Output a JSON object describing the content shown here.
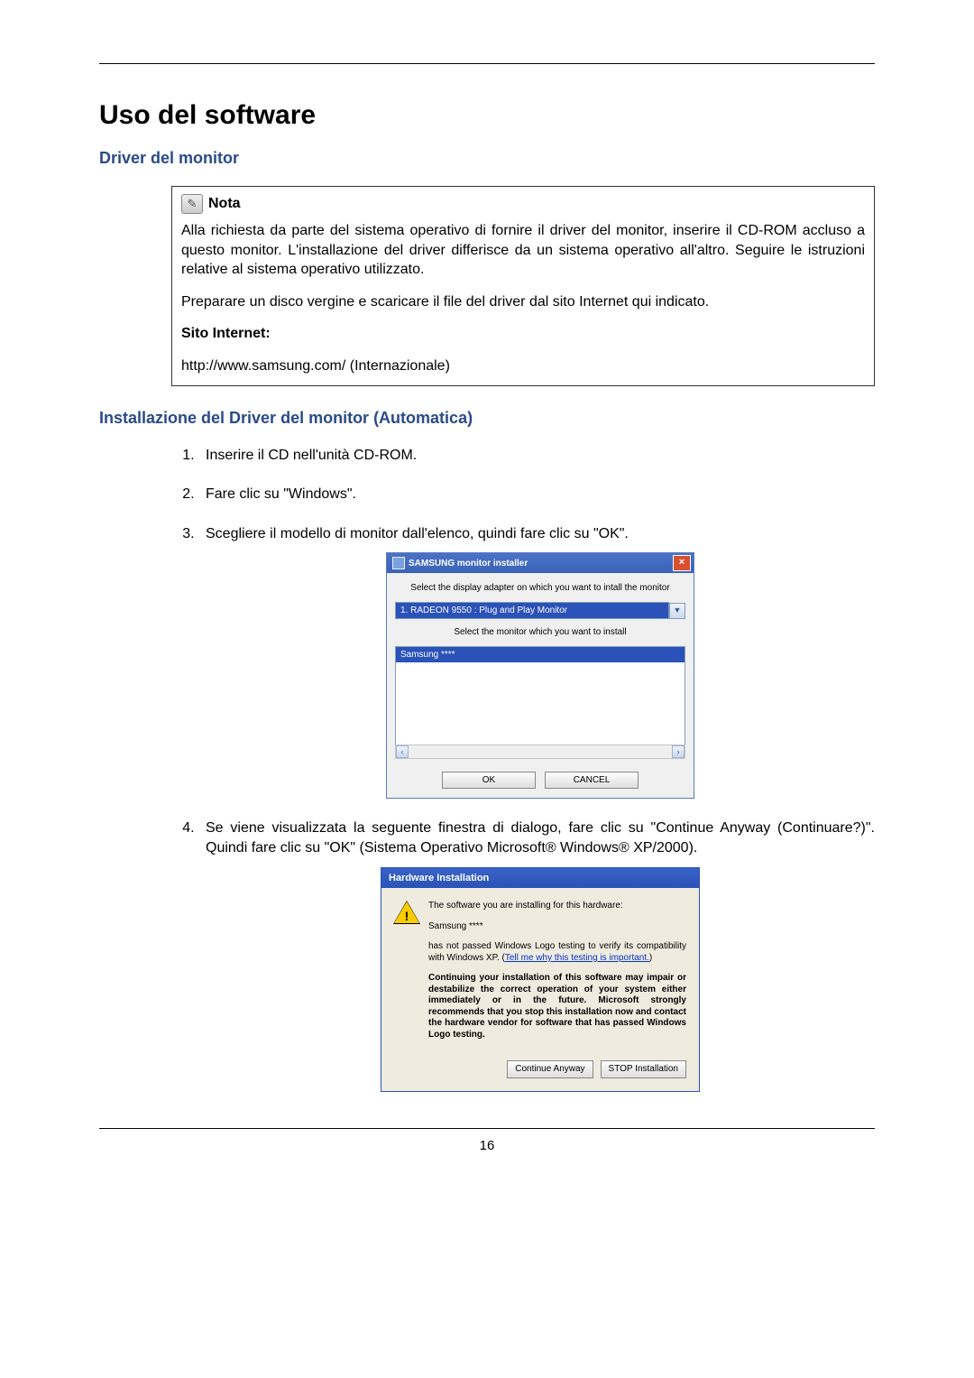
{
  "page_number": "16",
  "heading": "Uso del software",
  "section1_title": "Driver del monitor",
  "note": {
    "icon_glyph": "✎",
    "title": "Nota",
    "para1": "Alla richiesta da parte del sistema operativo di fornire il driver del monitor, inserire il CD-ROM accluso a questo monitor. L'installazione del driver differisce da un sistema operativo all'altro. Seguire le istruzioni relative al sistema operativo utilizzato.",
    "para2": "Preparare un disco vergine e scaricare il file del driver dal sito Internet qui indicato.",
    "site_label": "Sito Internet:",
    "url": "http://www.samsung.com/ (Internazionale)"
  },
  "section2_title": "Installazione del Driver del monitor (Automatica)",
  "steps": {
    "s1": "Inserire il CD nell'unità CD-ROM.",
    "s2": "Fare clic su \"Windows\".",
    "s3": "Scegliere il modello di monitor dall'elenco, quindi fare clic su \"OK\".",
    "s4": "Se viene visualizzata la seguente finestra di dialogo, fare clic su \"Continue Anyway (Continuare?)\". Quindi fare clic su \"OK\" (Sistema Operativo Microsoft® Windows® XP/2000)."
  },
  "installer": {
    "window_title": "SAMSUNG monitor installer",
    "close_glyph": "×",
    "label_adapter": "Select the display adapter on which you want to intall the monitor",
    "adapter_value": "1. RADEON 9550 : Plug and Play Monitor",
    "drop_glyph": "▼",
    "label_monitor": "Select the monitor which you want to install",
    "monitor_value": "Samsung ****",
    "scroll_left": "‹",
    "scroll_right": "›",
    "btn_ok": "OK",
    "btn_cancel": "CANCEL"
  },
  "hwdialog": {
    "title": "Hardware Installation",
    "warn_glyph": "!",
    "line1": "The software you are installing for this hardware:",
    "product": "Samsung ****",
    "line2a": "has not passed Windows Logo testing to verify its compatibility with Windows XP. (",
    "link": "Tell me why this testing is important.",
    "line2b": ")",
    "bold": "Continuing your installation of this software may impair or destabilize the correct operation of your system either immediately or in the future. Microsoft strongly recommends that you stop this installation now and contact the hardware vendor for software that has passed Windows Logo testing.",
    "btn_continue": "Continue Anyway",
    "btn_stop": "STOP Installation"
  }
}
